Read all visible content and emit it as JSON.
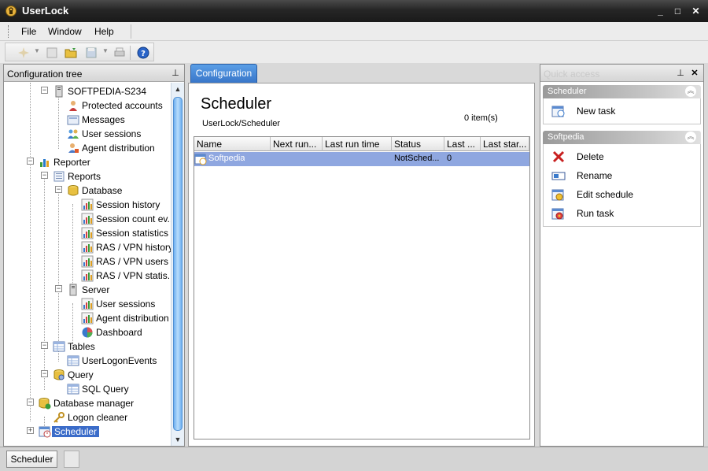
{
  "window": {
    "title": "UserLock",
    "minimize": "_",
    "maximize": "□",
    "close": "✕"
  },
  "menu": [
    {
      "label": "File"
    },
    {
      "label": "Window"
    },
    {
      "label": "Help"
    }
  ],
  "left_panel": {
    "title": "Configuration tree",
    "pin": "⊥",
    "items": [
      {
        "label": "SOFTPEDIA-S234",
        "icon": "server-icon"
      },
      {
        "label": "Protected accounts",
        "icon": "users-icon"
      },
      {
        "label": "Messages",
        "icon": "messages-icon"
      },
      {
        "label": "User sessions",
        "icon": "user-sessions-icon"
      },
      {
        "label": "Agent distribution",
        "icon": "agent-icon"
      },
      {
        "label": "Reporter",
        "icon": "reporter-icon"
      },
      {
        "label": "Reports",
        "icon": "reports-icon"
      },
      {
        "label": "Database",
        "icon": "database-icon"
      },
      {
        "label": "Session history",
        "icon": "report-icon"
      },
      {
        "label": "Session count ev...",
        "icon": "report-icon"
      },
      {
        "label": "Session statistics",
        "icon": "report-icon"
      },
      {
        "label": "RAS / VPN history",
        "icon": "report-icon"
      },
      {
        "label": "RAS / VPN users ...",
        "icon": "report-icon"
      },
      {
        "label": "RAS / VPN statis...",
        "icon": "report-icon"
      },
      {
        "label": "Server",
        "icon": "server-icon"
      },
      {
        "label": "User sessions",
        "icon": "report-icon"
      },
      {
        "label": "Agent distribution",
        "icon": "report-icon"
      },
      {
        "label": "Dashboard",
        "icon": "dashboard-icon"
      },
      {
        "label": "Tables",
        "icon": "table-icon"
      },
      {
        "label": "UserLogonEvents",
        "icon": "table-icon"
      },
      {
        "label": "Query",
        "icon": "query-icon"
      },
      {
        "label": "SQL Query",
        "icon": "table-icon"
      },
      {
        "label": "Database manager",
        "icon": "database-manager-icon"
      },
      {
        "label": "Logon cleaner",
        "icon": "key-icon"
      },
      {
        "label": "Scheduler",
        "icon": "scheduler-icon"
      }
    ]
  },
  "center": {
    "tab": "Configuration",
    "title": "Scheduler",
    "breadcrumb": "UserLock/Scheduler",
    "count": "0 item(s)",
    "columns": [
      "Name",
      "Next run...",
      "Last run time",
      "Status",
      "Last ...",
      "Last star..."
    ],
    "rows": [
      {
        "name": "Softpedia",
        "next_run": "",
        "last_run": "",
        "status": "NotSched...",
        "last": "0",
        "last_start": ""
      }
    ]
  },
  "right_panel": {
    "title": "Quick access",
    "sections": [
      {
        "title": "Scheduler",
        "items": [
          {
            "label": "New task",
            "icon": "new-task-icon"
          }
        ]
      },
      {
        "title": "Softpedia",
        "items": [
          {
            "label": "Delete",
            "icon": "delete-icon"
          },
          {
            "label": "Rename",
            "icon": "rename-icon"
          },
          {
            "label": "Edit schedule",
            "icon": "edit-schedule-icon"
          },
          {
            "label": "Run task",
            "icon": "run-task-icon"
          }
        ]
      }
    ]
  },
  "statusbar": {
    "button": "Scheduler"
  }
}
